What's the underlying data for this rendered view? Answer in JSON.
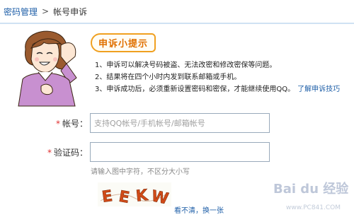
{
  "breadcrumb": {
    "parent": "密码管理",
    "separator": ">",
    "current": "帐号申诉"
  },
  "tips": {
    "title": "申诉小提示",
    "items": [
      "1、申诉可以解决号码被盗、无法改密和修改密保等问题。",
      "2、结果将在四个小时内发到联系邮箱或手机。",
      "3、申诉成功后，必须重新设置密码和密保，才能继续使用QQ。"
    ],
    "link": "了解申诉技巧"
  },
  "form": {
    "required_mark": "*",
    "account": {
      "label": "帐号：",
      "placeholder": "支持QQ帐号/手机帐号/邮箱帐号",
      "value": ""
    },
    "captcha": {
      "label": "验证码：",
      "value": "",
      "hint": "请输入图中字符，不区分大小写",
      "image_text": "EEKW",
      "refresh": "看不清，换一张"
    }
  },
  "watermark": {
    "logo": "Bai du 经验",
    "url": "www.PC841.COM"
  },
  "colors": {
    "link": "#1f5fa8",
    "required": "#e03030",
    "tip_border": "#f0a020",
    "tip_title": "#e07000"
  }
}
